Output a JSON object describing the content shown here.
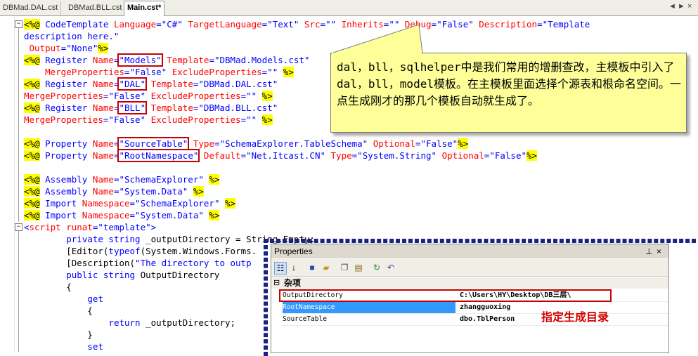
{
  "tabs": [
    "DBMad.DAL.cst",
    "DBMad.BLL.cst",
    "Main.cst*"
  ],
  "tab_controls": [
    "◄",
    "►",
    "×"
  ],
  "code_lines": [
    [
      {
        "t": "<%@",
        "c": "tagbg"
      },
      {
        "t": " CodeTemplate ",
        "c": "kw"
      },
      {
        "t": "Language",
        "c": "attr"
      },
      {
        "t": "=\"C#\" ",
        "c": "val"
      },
      {
        "t": "TargetLanguage",
        "c": "attr"
      },
      {
        "t": "=\"Text\" ",
        "c": "val"
      },
      {
        "t": "Src",
        "c": "attr"
      },
      {
        "t": "=\"\" ",
        "c": "val"
      },
      {
        "t": "Inherits",
        "c": "attr"
      },
      {
        "t": "=\"\" ",
        "c": "val"
      },
      {
        "t": "Debug",
        "c": "attr"
      },
      {
        "t": "=\"False\" ",
        "c": "val"
      },
      {
        "t": "Description",
        "c": "attr"
      },
      {
        "t": "=\"Template",
        "c": "val"
      }
    ],
    [
      {
        "t": "description here.\"",
        "c": "val"
      }
    ],
    [
      {
        "t": " ",
        "c": "plain"
      },
      {
        "t": "Output",
        "c": "attr"
      },
      {
        "t": "=\"None\"",
        "c": "val"
      },
      {
        "t": "%>",
        "c": "tagbg"
      }
    ],
    [
      {
        "t": "<%@",
        "c": "tagbg"
      },
      {
        "t": " Register ",
        "c": "kw"
      },
      {
        "t": "Name",
        "c": "attr"
      },
      {
        "t": "=",
        "c": "val"
      },
      {
        "t": "\"Models\"",
        "c": "val",
        "box": true
      },
      {
        "t": " Template",
        "c": "attr"
      },
      {
        "t": "=\"DBMad.Models.cst\"",
        "c": "val"
      }
    ],
    [
      {
        "t": "    ",
        "c": "plain"
      },
      {
        "t": "MergeProperties",
        "c": "attr"
      },
      {
        "t": "=\"False\" ",
        "c": "val"
      },
      {
        "t": "ExcludeProperties",
        "c": "attr"
      },
      {
        "t": "=\"\" ",
        "c": "val"
      },
      {
        "t": "%>",
        "c": "tagbg"
      }
    ],
    [
      {
        "t": "<%@",
        "c": "tagbg"
      },
      {
        "t": " Register ",
        "c": "kw"
      },
      {
        "t": "Name",
        "c": "attr"
      },
      {
        "t": "=",
        "c": "val"
      },
      {
        "t": "\"DAL\"",
        "c": "val",
        "box": true
      },
      {
        "t": " Template",
        "c": "attr"
      },
      {
        "t": "=\"DBMad.DAL.cst\"",
        "c": "val"
      }
    ],
    [
      {
        "t": "MergeProperties",
        "c": "attr"
      },
      {
        "t": "=\"False\" ",
        "c": "val"
      },
      {
        "t": "ExcludeProperties",
        "c": "attr"
      },
      {
        "t": "=\"\" ",
        "c": "val"
      },
      {
        "t": "%>",
        "c": "tagbg"
      }
    ],
    [
      {
        "t": "<%@",
        "c": "tagbg"
      },
      {
        "t": " Register ",
        "c": "kw"
      },
      {
        "t": "Name",
        "c": "attr"
      },
      {
        "t": "=",
        "c": "val"
      },
      {
        "t": "\"BLL\"",
        "c": "val",
        "box": true
      },
      {
        "t": " Template",
        "c": "attr"
      },
      {
        "t": "=\"DBMad.BLL.cst\"",
        "c": "val"
      }
    ],
    [
      {
        "t": "MergeProperties",
        "c": "attr"
      },
      {
        "t": "=\"False\" ",
        "c": "val"
      },
      {
        "t": "ExcludeProperties",
        "c": "attr"
      },
      {
        "t": "=\"\" ",
        "c": "val"
      },
      {
        "t": "%>",
        "c": "tagbg"
      }
    ],
    [],
    [
      {
        "t": "<%@",
        "c": "tagbg"
      },
      {
        "t": " Property ",
        "c": "kw"
      },
      {
        "t": "Name",
        "c": "attr"
      },
      {
        "t": "=",
        "c": "val"
      },
      {
        "t": "\"SourceTable\"",
        "c": "val",
        "box": true
      },
      {
        "t": " Type",
        "c": "attr"
      },
      {
        "t": "=\"SchemaExplorer.TableSchema\" ",
        "c": "val"
      },
      {
        "t": "Optional",
        "c": "attr"
      },
      {
        "t": "=\"False\"",
        "c": "val"
      },
      {
        "t": "%>",
        "c": "tagbg"
      }
    ],
    [
      {
        "t": "<%@",
        "c": "tagbg"
      },
      {
        "t": " Property ",
        "c": "kw"
      },
      {
        "t": "Name",
        "c": "attr"
      },
      {
        "t": "=",
        "c": "val"
      },
      {
        "t": "\"RootNamespace\"",
        "c": "val",
        "box": true
      },
      {
        "t": " Default",
        "c": "attr"
      },
      {
        "t": "=\"Net.Itcast.CN\" ",
        "c": "val"
      },
      {
        "t": "Type",
        "c": "attr"
      },
      {
        "t": "=\"System.String\" ",
        "c": "val"
      },
      {
        "t": "Optional",
        "c": "attr"
      },
      {
        "t": "=\"False\"",
        "c": "val"
      },
      {
        "t": "%>",
        "c": "tagbg"
      }
    ],
    [],
    [
      {
        "t": "<%@",
        "c": "tagbg"
      },
      {
        "t": " Assembly ",
        "c": "kw"
      },
      {
        "t": "Name",
        "c": "attr"
      },
      {
        "t": "=\"SchemaExplorer\" ",
        "c": "val"
      },
      {
        "t": "%>",
        "c": "tagbg"
      }
    ],
    [
      {
        "t": "<%@",
        "c": "tagbg"
      },
      {
        "t": " Assembly ",
        "c": "kw"
      },
      {
        "t": "Name",
        "c": "attr"
      },
      {
        "t": "=\"System.Data\" ",
        "c": "val"
      },
      {
        "t": "%>",
        "c": "tagbg"
      }
    ],
    [
      {
        "t": "<%@",
        "c": "tagbg"
      },
      {
        "t": " Import ",
        "c": "kw"
      },
      {
        "t": "Namespace",
        "c": "attr"
      },
      {
        "t": "=\"SchemaExplorer\" ",
        "c": "val"
      },
      {
        "t": "%>",
        "c": "tagbg"
      }
    ],
    [
      {
        "t": "<%@",
        "c": "tagbg"
      },
      {
        "t": " Import ",
        "c": "kw"
      },
      {
        "t": "Namespace",
        "c": "attr"
      },
      {
        "t": "=\"System.Data\" ",
        "c": "val"
      },
      {
        "t": "%>",
        "c": "tagbg"
      }
    ],
    [
      {
        "t": "<",
        "c": "val"
      },
      {
        "t": "script ",
        "c": "attr"
      },
      {
        "t": "runat",
        "c": "attr"
      },
      {
        "t": "=\"template\">",
        "c": "val"
      }
    ],
    [
      {
        "t": "        ",
        "c": "plain"
      },
      {
        "t": "private string ",
        "c": "kw"
      },
      {
        "t": "_outputDirectory = String.Empty;",
        "c": "plain"
      }
    ],
    [
      {
        "t": "        [Editor(",
        "c": "plain"
      },
      {
        "t": "typeof",
        "c": "kw"
      },
      {
        "t": "(System.Windows.Forms.",
        "c": "plain"
      }
    ],
    [
      {
        "t": "        [Description(",
        "c": "plain"
      },
      {
        "t": "\"The directory to outp",
        "c": "val"
      }
    ],
    [
      {
        "t": "        ",
        "c": "plain"
      },
      {
        "t": "public string ",
        "c": "kw"
      },
      {
        "t": "OutputDirectory",
        "c": "plain"
      }
    ],
    [
      {
        "t": "        {",
        "c": "plain"
      }
    ],
    [
      {
        "t": "            ",
        "c": "plain"
      },
      {
        "t": "get",
        "c": "kw"
      }
    ],
    [
      {
        "t": "            {",
        "c": "plain"
      }
    ],
    [
      {
        "t": "                ",
        "c": "plain"
      },
      {
        "t": "return ",
        "c": "kw"
      },
      {
        "t": "_outputDirectory;",
        "c": "plain"
      }
    ],
    [
      {
        "t": "            }",
        "c": "plain"
      }
    ],
    [
      {
        "t": "            ",
        "c": "plain"
      },
      {
        "t": "set",
        "c": "kw"
      }
    ]
  ],
  "callout": {
    "text": "dal，bll，sqlhelper中是我们常用的增删查改，主模板中引入了dal，bll，model模板。在主模板里面选择个源表和根命名空间。一点生成刚才的那几个模板自动就生成了。"
  },
  "properties": {
    "title": "Properties",
    "pin": "⊥",
    "close": "×",
    "category": "杂项",
    "category_toggle": "⊟",
    "toolbar_icons": [
      "categorized-icon",
      "alphabetical-icon",
      "save-icon",
      "open-icon",
      "copy-icon",
      "paste-icon",
      "refresh-icon",
      "undo-icon"
    ],
    "rows": [
      {
        "key": "OutputDirectory",
        "value": "C:\\Users\\HY\\Desktop\\DB三层\\"
      },
      {
        "key": "RootNamespace",
        "value": "zhangguoxing"
      },
      {
        "key": "SourceTable",
        "value": "dbo.TblPerson"
      }
    ]
  },
  "annotation": "指定生成目录",
  "colors": {
    "highlight": "#ffff00",
    "callout_bg": "#ffff99",
    "annotation": "#d40000",
    "box": "#c40000",
    "dash": "#1a237e",
    "selection": "#3399ff"
  }
}
